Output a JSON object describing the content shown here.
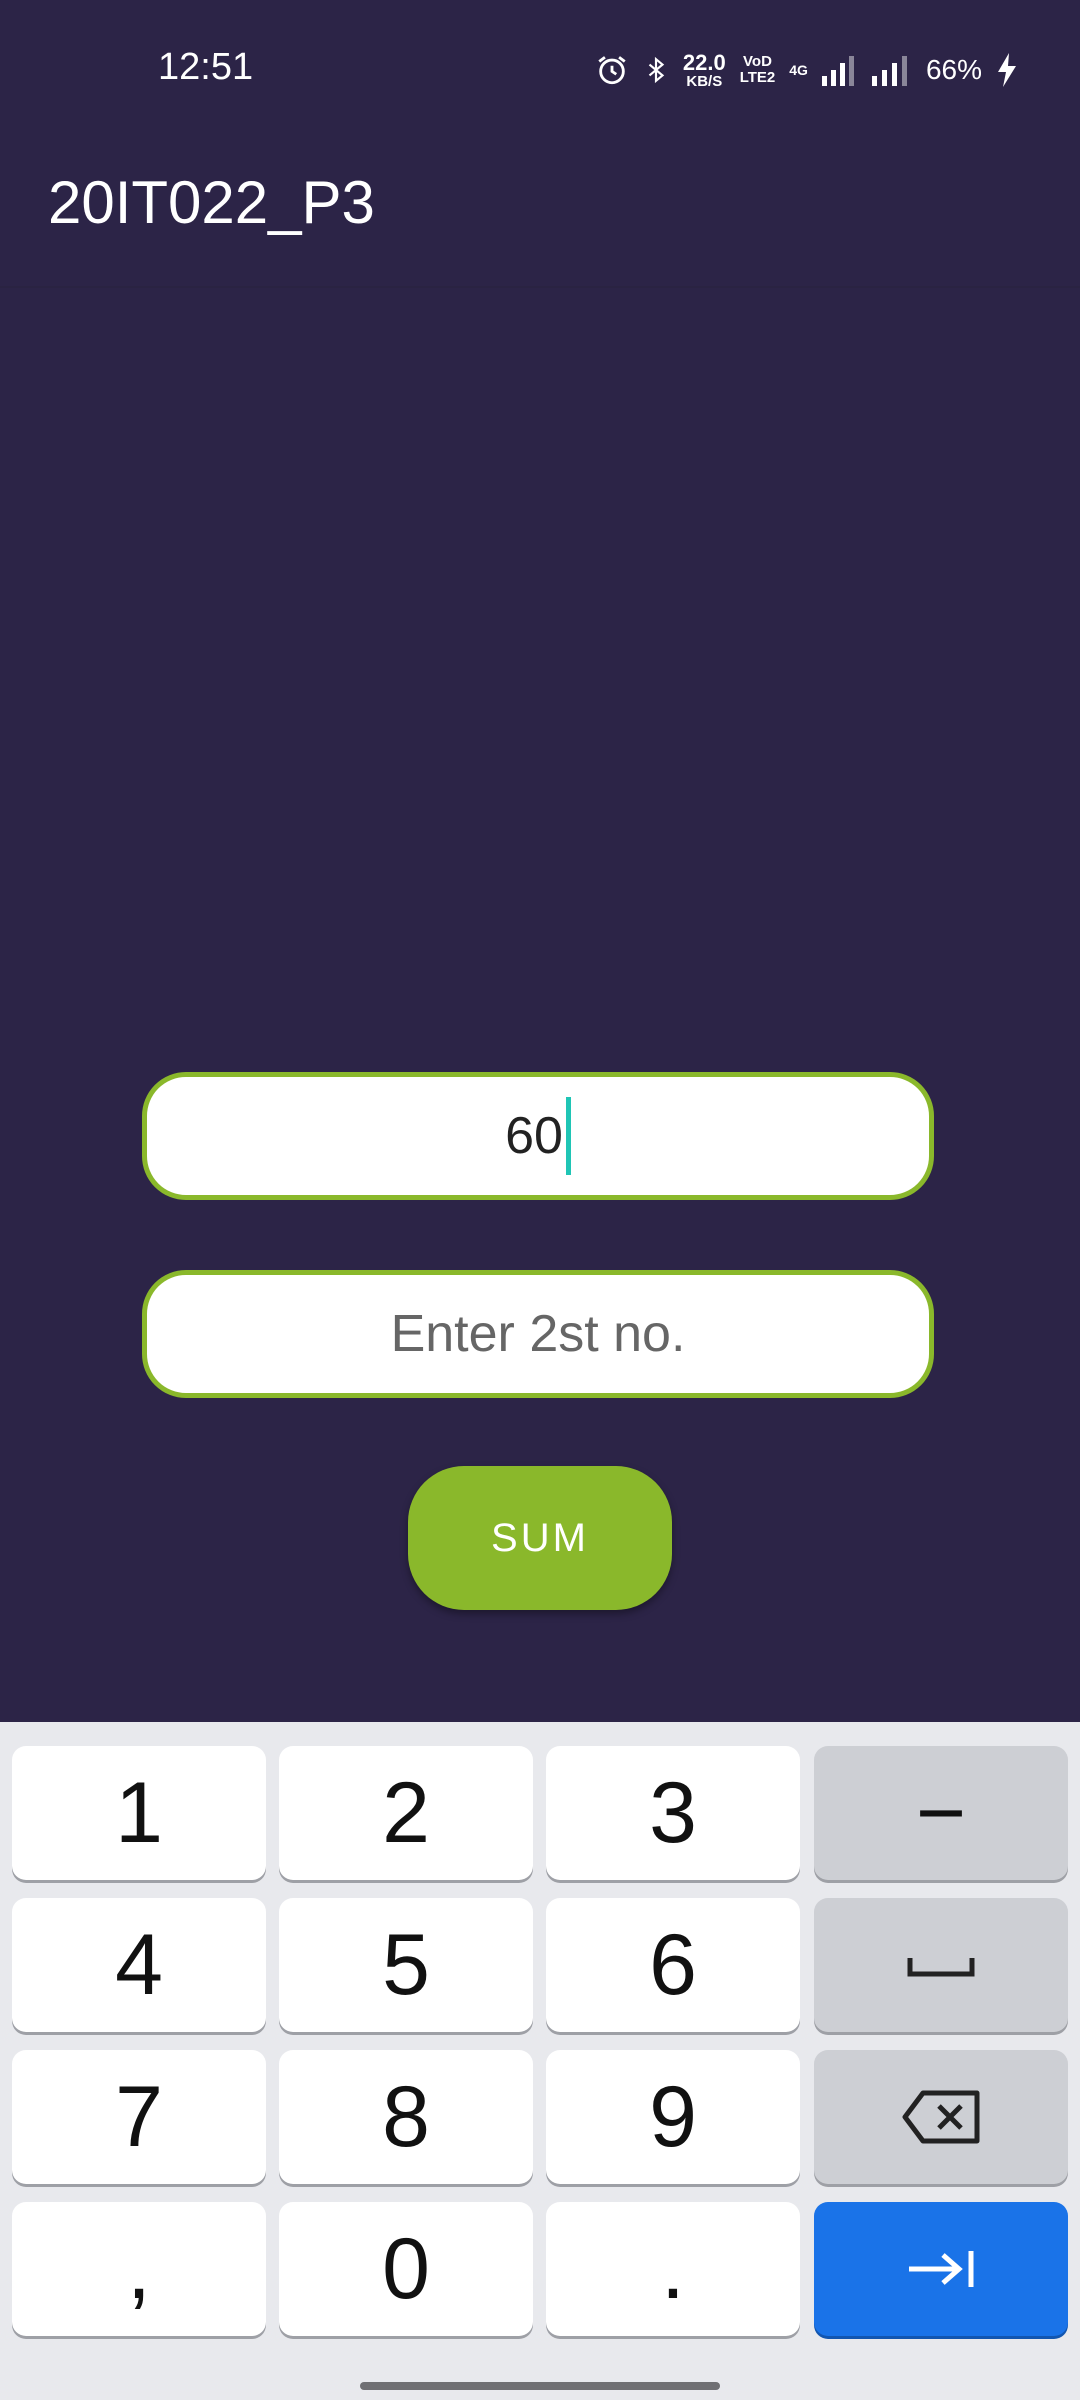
{
  "status_bar": {
    "time": "12:51",
    "data_speed": "22.0",
    "data_unit": "KB/S",
    "volte_top": "VoD",
    "volte_bottom": "LTE2",
    "network": "4G",
    "battery": "66%"
  },
  "app_bar": {
    "title": "20IT022_P3"
  },
  "form": {
    "first_number_value": "60",
    "second_number_placeholder": "Enter 2st no.",
    "sum_button_label": "SUM"
  },
  "keyboard": {
    "row1": [
      "1",
      "2",
      "3",
      "−"
    ],
    "row2": [
      "4",
      "5",
      "6"
    ],
    "row3": [
      "7",
      "8",
      "9"
    ],
    "row4": [
      ",",
      "0",
      "."
    ],
    "icons": {
      "space": "space-bar-icon",
      "backspace": "backspace-icon",
      "enter": "tab-next-icon"
    }
  },
  "colors": {
    "background": "#2c2447",
    "accent_green": "#8ab82b",
    "cursor": "#1fc5b5",
    "enter_key": "#1a73e8"
  }
}
